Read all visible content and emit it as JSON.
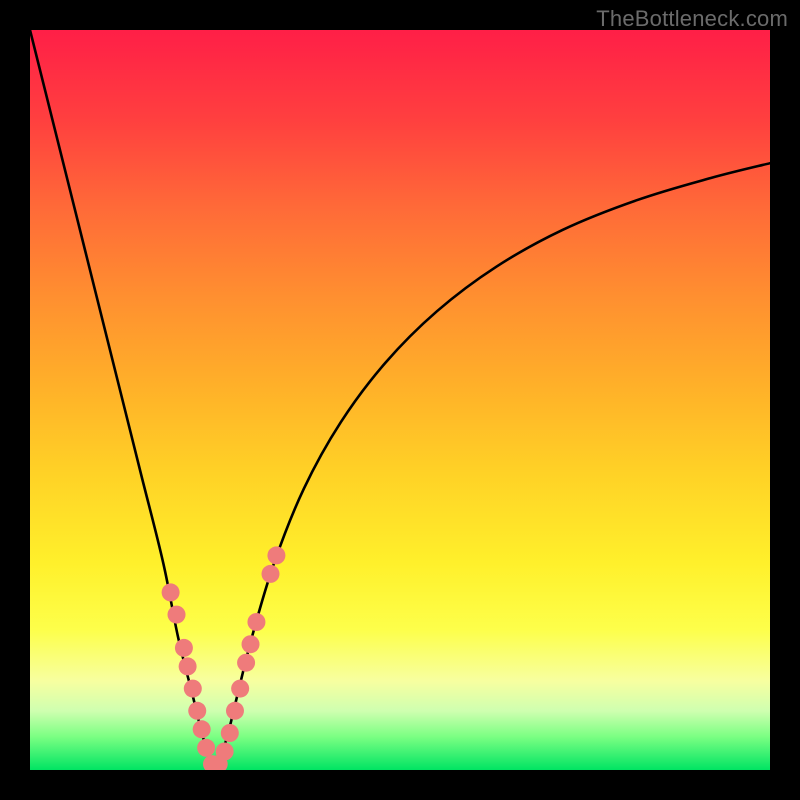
{
  "watermark": "TheBottleneck.com",
  "chart_data": {
    "type": "line",
    "title": "",
    "xlabel": "",
    "ylabel": "",
    "xlim": [
      0,
      100
    ],
    "ylim": [
      0,
      100
    ],
    "grid": false,
    "legend": false,
    "vertex_x": 25,
    "series": [
      {
        "name": "bottleneck-curve",
        "x": [
          0,
          3,
          6,
          9,
          12,
          15,
          18,
          20,
          22,
          23.5,
          25,
          26.5,
          28,
          30,
          33,
          37,
          42,
          48,
          55,
          63,
          72,
          82,
          92,
          100
        ],
        "y": [
          100,
          88,
          76,
          64,
          52,
          40,
          28,
          18,
          10,
          4,
          0,
          4,
          10,
          18,
          28,
          38,
          47,
          55,
          62,
          68,
          73,
          77,
          80,
          82
        ]
      }
    ],
    "markers": [
      {
        "x": 19.0,
        "y": 24.0
      },
      {
        "x": 19.8,
        "y": 21.0
      },
      {
        "x": 20.8,
        "y": 16.5
      },
      {
        "x": 21.3,
        "y": 14.0
      },
      {
        "x": 22.0,
        "y": 11.0
      },
      {
        "x": 22.6,
        "y": 8.0
      },
      {
        "x": 23.2,
        "y": 5.5
      },
      {
        "x": 23.8,
        "y": 3.0
      },
      {
        "x": 24.6,
        "y": 0.8
      },
      {
        "x": 25.5,
        "y": 0.8
      },
      {
        "x": 26.3,
        "y": 2.5
      },
      {
        "x": 27.0,
        "y": 5.0
      },
      {
        "x": 27.7,
        "y": 8.0
      },
      {
        "x": 28.4,
        "y": 11.0
      },
      {
        "x": 29.2,
        "y": 14.5
      },
      {
        "x": 29.8,
        "y": 17.0
      },
      {
        "x": 30.6,
        "y": 20.0
      },
      {
        "x": 32.5,
        "y": 26.5
      },
      {
        "x": 33.3,
        "y": 29.0
      }
    ],
    "marker_color": "#ef7b7b",
    "curve_color": "#000000"
  }
}
